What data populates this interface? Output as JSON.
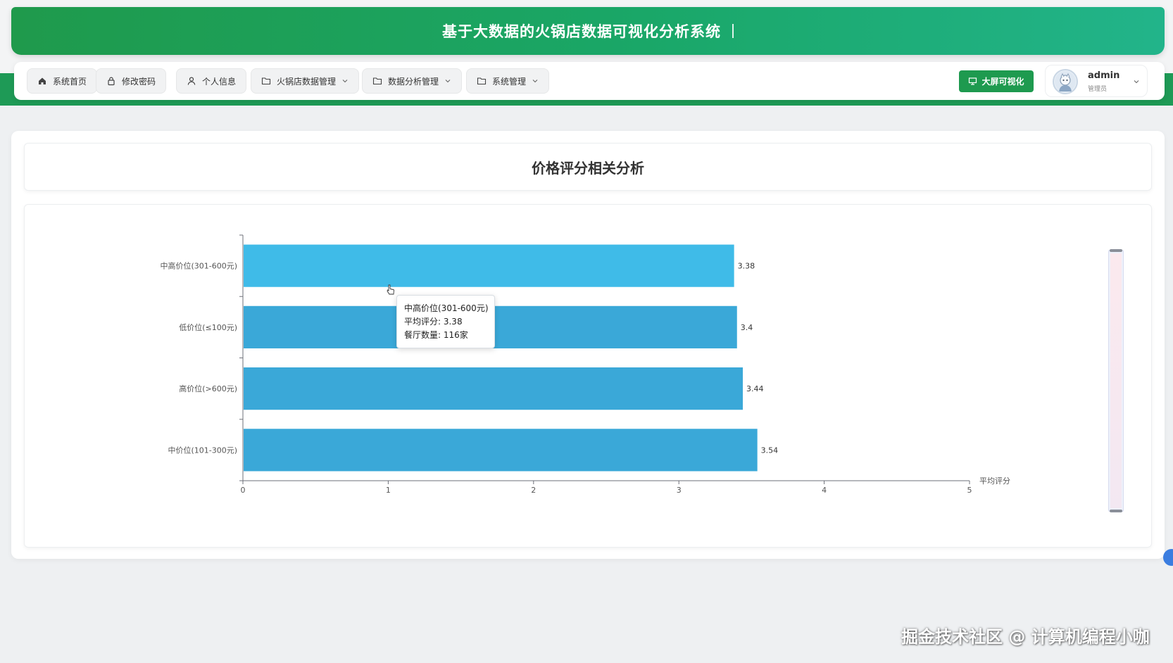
{
  "header": {
    "title": "基于大数据的火锅店数据可视化分析系统"
  },
  "nav": {
    "items": [
      {
        "label": "系统首页",
        "icon": "home-icon",
        "dropdown": false
      },
      {
        "label": "修改密码",
        "icon": "lock-icon",
        "dropdown": false
      },
      {
        "label": "个人信息",
        "icon": "user-icon",
        "dropdown": false
      },
      {
        "label": "火锅店数据管理",
        "icon": "folder-icon",
        "dropdown": true
      },
      {
        "label": "数据分析管理",
        "icon": "folder-icon",
        "dropdown": true
      },
      {
        "label": "系统管理",
        "icon": "folder-icon",
        "dropdown": true
      }
    ],
    "bigscreen_label": "大屏可视化",
    "user": {
      "name": "admin",
      "role": "管理员"
    }
  },
  "page": {
    "title": "价格评分相关分析"
  },
  "chart_data": {
    "type": "bar",
    "orientation": "horizontal",
    "categories": [
      "中高价位(301-600元)",
      "低价位(≤100元)",
      "高价位(>600元)",
      "中价位(101-300元)"
    ],
    "values": [
      3.38,
      3.4,
      3.44,
      3.54
    ],
    "value_labels": [
      "3.38",
      "3.4",
      "3.44",
      "3.54"
    ],
    "xlabel": "平均评分",
    "xlim": [
      0,
      5
    ],
    "xticks": [
      "0",
      "1",
      "2",
      "3",
      "4",
      "5"
    ],
    "colors": {
      "bar": "#3aa8d8",
      "bar_highlight": "#3fbbe8",
      "axis": "#6e7079",
      "label": "#555555"
    },
    "highlighted_index": 0,
    "grid": false
  },
  "tooltip": {
    "line1": "中高价位(301-600元)",
    "line2": "平均评分: 3.38",
    "line3": "餐厅数量: 116家"
  },
  "watermark": "掘金技术社区 @ 计算机编程小咖",
  "colors": {
    "brand_green": "#1e9a4f",
    "title_gradient_start": "#1f9a4c",
    "title_gradient_end": "#22b48a"
  }
}
